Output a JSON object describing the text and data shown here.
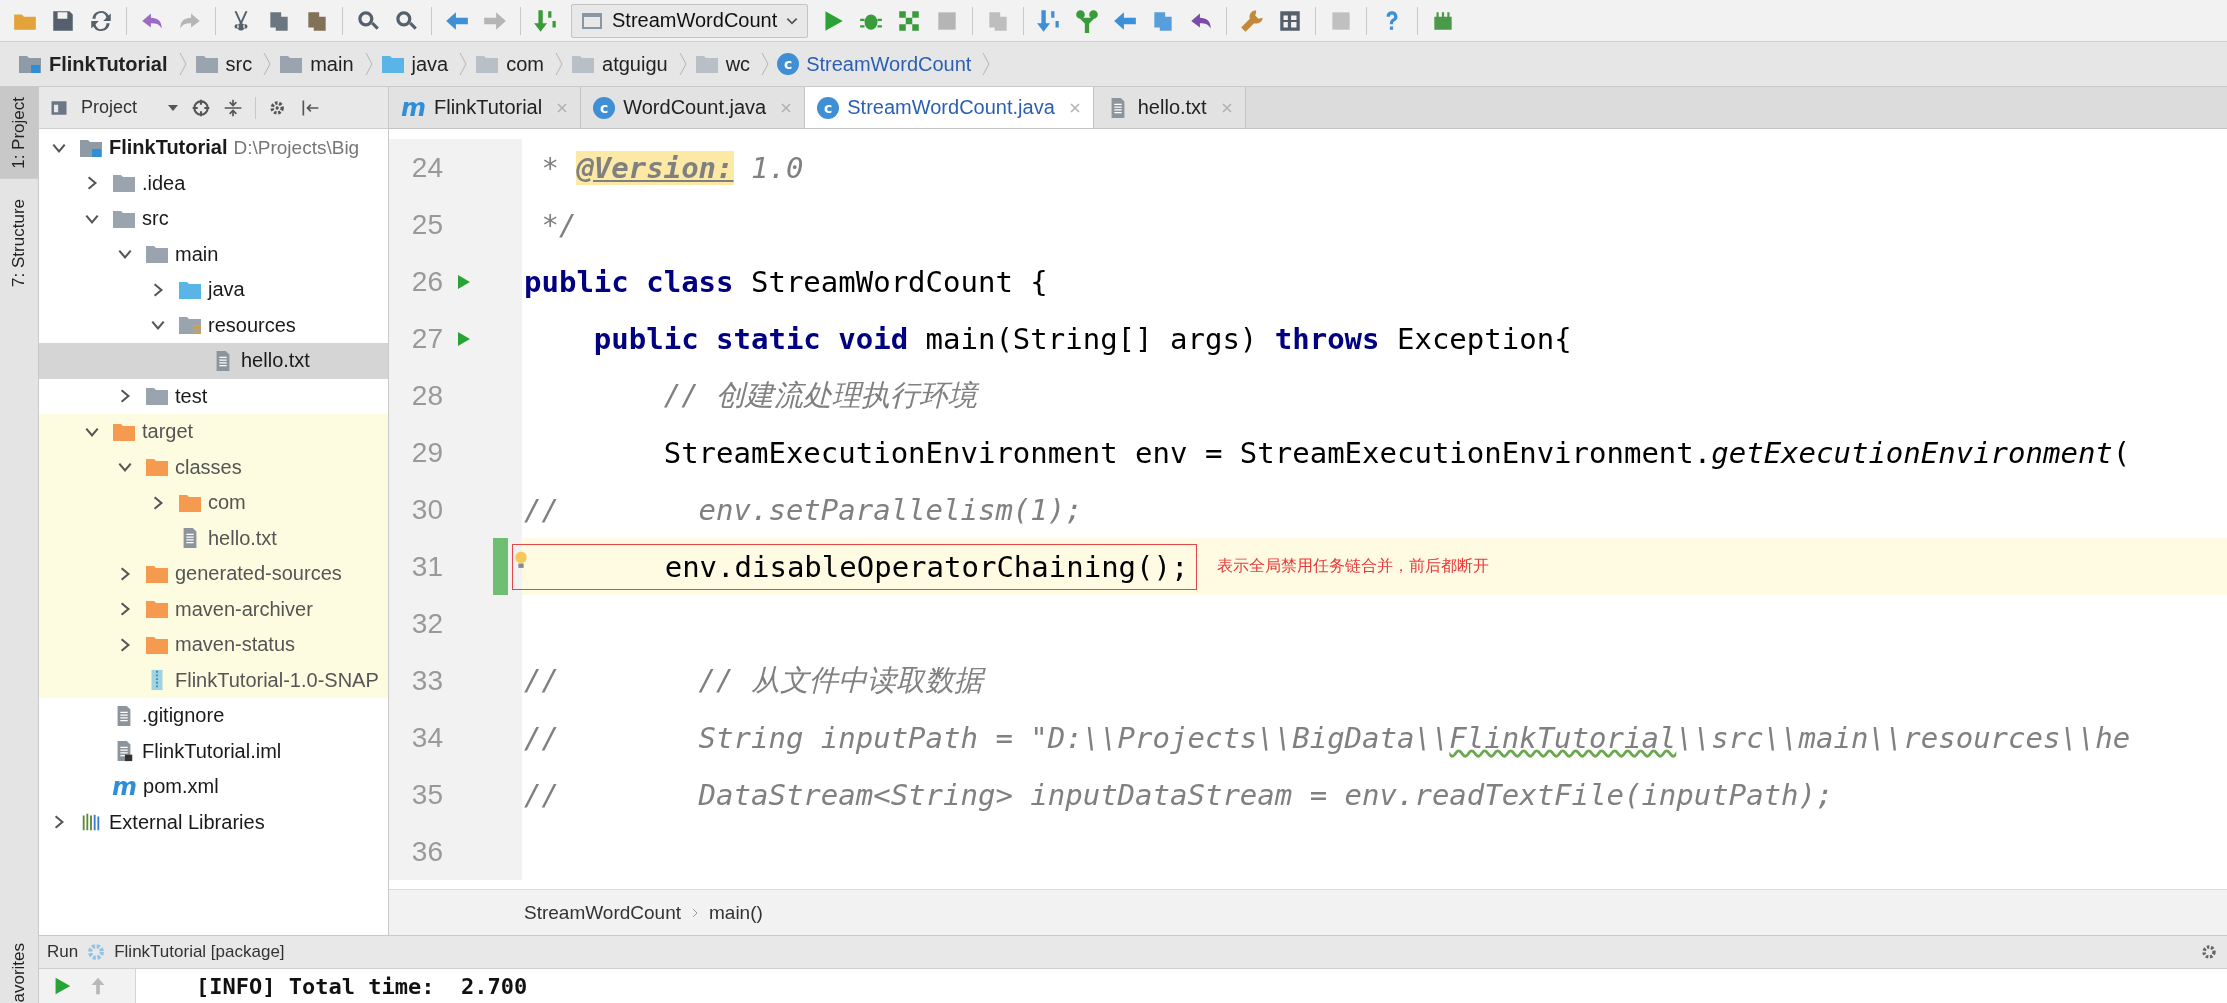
{
  "toolbar": {
    "run_config": "StreamWordCount"
  },
  "navbar": [
    {
      "label": "FlinkTutorial",
      "kind": "module"
    },
    {
      "label": "src",
      "kind": "folder"
    },
    {
      "label": "main",
      "kind": "folder"
    },
    {
      "label": "java",
      "kind": "source-folder"
    },
    {
      "label": "com",
      "kind": "package"
    },
    {
      "label": "atguigu",
      "kind": "package"
    },
    {
      "label": "wc",
      "kind": "package"
    },
    {
      "label": "StreamWordCount",
      "kind": "class",
      "icon_text": "c"
    }
  ],
  "side_stripe": [
    {
      "label": "1: Project",
      "selected": true
    },
    {
      "label": "7: Structure",
      "selected": false
    },
    {
      "label": "avorites",
      "selected": false
    }
  ],
  "project": {
    "title": "Project",
    "tree": [
      {
        "label": "FlinkTutorial",
        "path": "D:\\Projects\\Big",
        "kind": "module",
        "expanded": true,
        "selected": false,
        "children": [
          {
            "label": ".idea",
            "kind": "folder",
            "expanded": false,
            "selected": false
          },
          {
            "label": "src",
            "kind": "folder",
            "expanded": true,
            "selected": false,
            "children": [
              {
                "label": "main",
                "kind": "folder",
                "expanded": true,
                "selected": false,
                "children": [
                  {
                    "label": "java",
                    "kind": "source-folder",
                    "expanded": false,
                    "selected": false
                  },
                  {
                    "label": "resources",
                    "kind": "resource-folder",
                    "expanded": true,
                    "selected": false,
                    "children": [
                      {
                        "label": "hello.txt",
                        "kind": "text-file",
                        "selected": true
                      }
                    ]
                  }
                ]
              },
              {
                "label": "test",
                "kind": "folder",
                "expanded": false,
                "selected": false
              }
            ]
          },
          {
            "label": "target",
            "kind": "excluded-folder",
            "expanded": true,
            "selected": false,
            "children": [
              {
                "label": "classes",
                "kind": "excluded-folder",
                "expanded": true,
                "selected": false,
                "children": [
                  {
                    "label": "com",
                    "kind": "excluded-folder",
                    "expanded": false,
                    "selected": false
                  },
                  {
                    "label": "hello.txt",
                    "kind": "text-file",
                    "selected": false
                  }
                ]
              },
              {
                "label": "generated-sources",
                "kind": "excluded-folder",
                "expanded": false,
                "selected": false
              },
              {
                "label": "maven-archiver",
                "kind": "excluded-folder",
                "expanded": false,
                "selected": false
              },
              {
                "label": "maven-status",
                "kind": "excluded-folder",
                "expanded": false,
                "selected": false
              },
              {
                "label": "FlinkTutorial-1.0-SNAP",
                "kind": "jar",
                "selected": false
              }
            ]
          },
          {
            "label": ".gitignore",
            "kind": "text-file",
            "selected": false
          },
          {
            "label": "FlinkTutorial.iml",
            "kind": "iml-file",
            "selected": false
          },
          {
            "label": "pom.xml",
            "kind": "maven-file",
            "icon_text": "m",
            "selected": false
          }
        ]
      },
      {
        "label": "External Libraries",
        "kind": "library",
        "expanded": false,
        "selected": false
      }
    ]
  },
  "tabs": [
    {
      "label": "FlinkTutorial",
      "kind": "maven",
      "icon_text": "m",
      "selected": false
    },
    {
      "label": "WordCount.java",
      "kind": "class",
      "icon_text": "c",
      "selected": false
    },
    {
      "label": "StreamWordCount.java",
      "kind": "class",
      "icon_text": "c",
      "selected": true
    },
    {
      "label": "hello.txt",
      "kind": "text",
      "selected": false
    }
  ],
  "editor": {
    "lines": [
      {
        "number": "24",
        "runnable": false,
        "current": false,
        "tokens": [
          {
            "text": " * ",
            "kind": "doc"
          },
          {
            "text": "@Version:",
            "kind": "doc-tag"
          },
          {
            "text": " 1.0",
            "kind": "doc"
          }
        ]
      },
      {
        "number": "25",
        "runnable": false,
        "current": false,
        "tokens": [
          {
            "text": " */",
            "kind": "doc"
          }
        ]
      },
      {
        "number": "26",
        "runnable": true,
        "current": false,
        "tokens": [
          {
            "text": "public class",
            "kind": "keyword"
          },
          {
            "text": " StreamWordCount {",
            "kind": "plain"
          }
        ]
      },
      {
        "number": "27",
        "runnable": true,
        "current": false,
        "tokens": [
          {
            "text": "    public static void",
            "kind": "keyword"
          },
          {
            "text": " main(String[] args) ",
            "kind": "plain"
          },
          {
            "text": "throws",
            "kind": "keyword"
          },
          {
            "text": " Exception{",
            "kind": "plain"
          }
        ]
      },
      {
        "number": "28",
        "runnable": false,
        "current": false,
        "tokens": [
          {
            "text": "        // 创建流处理执行环境",
            "kind": "comment"
          }
        ]
      },
      {
        "number": "29",
        "runnable": false,
        "current": false,
        "tokens": [
          {
            "text": "        StreamExecutionEnvironment env = StreamExecutionEnvironment.",
            "kind": "plain"
          },
          {
            "text": "getExecutionEnvironment",
            "kind": "static"
          },
          {
            "text": "(",
            "kind": "plain"
          }
        ]
      },
      {
        "number": "30",
        "runnable": false,
        "current": false,
        "tokens": [
          {
            "text": "//        env.setParallelism(1);",
            "kind": "comment"
          }
        ]
      },
      {
        "number": "31",
        "runnable": false,
        "current": true,
        "tokens": [
          {
            "text": "        env.disableOperatorChaining();",
            "kind": "plain"
          }
        ],
        "annotation": "表示全局禁用任务链合并，前后都断开"
      },
      {
        "number": "32",
        "runnable": false,
        "current": false
      },
      {
        "number": "33",
        "runnable": false,
        "current": false,
        "tokens": [
          {
            "text": "//        // 从文件中读取数据",
            "kind": "comment"
          }
        ]
      },
      {
        "number": "34",
        "runnable": false,
        "current": false,
        "tokens": [
          {
            "text": "//        String inputPath = \"D:\\\\Projects\\\\BigData\\\\",
            "kind": "comment"
          },
          {
            "text": "FlinkTutorial",
            "kind": "comment-typo"
          },
          {
            "text": "\\\\src\\\\main\\\\resources\\\\he",
            "kind": "comment"
          }
        ]
      },
      {
        "number": "35",
        "runnable": false,
        "current": false,
        "tokens": [
          {
            "text": "//        DataStream<String> inputDataStream = env.readTextFile(inputPath);",
            "kind": "comment"
          }
        ]
      },
      {
        "number": "36",
        "runnable": false,
        "current": false
      }
    ],
    "breadcrumb": [
      "StreamWordCount",
      "main()"
    ]
  },
  "run": {
    "title": "Run",
    "config": "FlinkTutorial [package]",
    "output": "[INFO] Total time:  2.700"
  }
}
